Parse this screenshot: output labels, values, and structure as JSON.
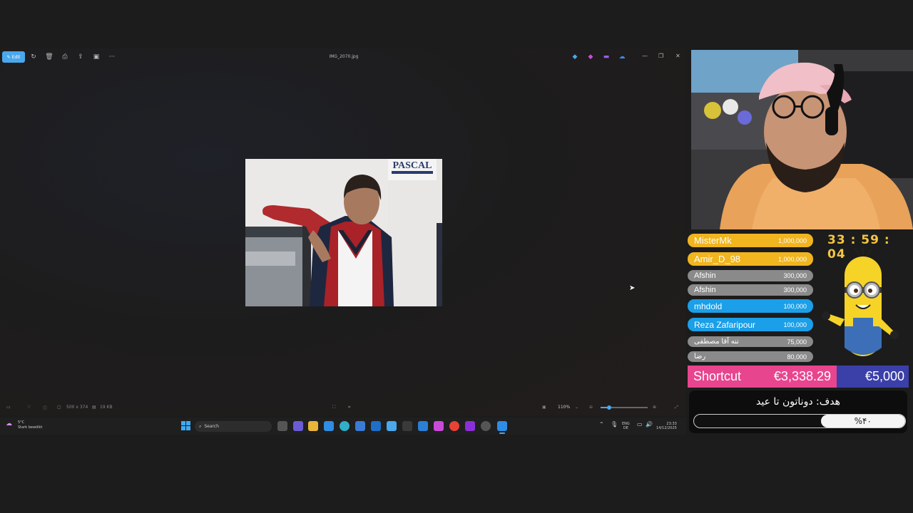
{
  "viewer": {
    "edit_label": "Edit",
    "filename": "IMG_2070.jpg",
    "photo_sign_text": "PASCAL",
    "status": {
      "dimensions": "500 x 374",
      "filesize": "19 KB",
      "zoom": "110%"
    }
  },
  "taskbar": {
    "weather_temp": "5°C",
    "weather_desc": "Stark bewölkt",
    "search_placeholder": "Search",
    "lang": "ENG",
    "region": "DE",
    "time": "23:33",
    "date": "14/12/2025"
  },
  "stream": {
    "timer": "33 : 59 : 04",
    "donors": [
      {
        "name": "MisterMk",
        "amount": "1,000,000",
        "tier": "gold"
      },
      {
        "name": "Amir_D_98",
        "amount": "1,000,000",
        "tier": "gold"
      },
      {
        "name": "Afshin",
        "amount": "300,000",
        "tier": "gray"
      },
      {
        "name": "Afshin",
        "amount": "300,000",
        "tier": "gray"
      },
      {
        "name": "mhdold",
        "amount": "100,000",
        "tier": "blue"
      },
      {
        "name": "Reza Zafaripour",
        "amount": "100,000",
        "tier": "blue"
      },
      {
        "name": "ننه آقا مصطفی",
        "amount": "75,000",
        "tier": "gray"
      },
      {
        "name": "رضا",
        "amount": "80,000",
        "tier": "gray"
      }
    ],
    "shortcut_label": "Shortcut",
    "shortcut_raised": "€3,338.29",
    "shortcut_goal": "€5,000",
    "goal_title": "هدف: دوناتون تا عید",
    "goal_percent_label": "%۴۰",
    "goal_percent": 40,
    "colors": {
      "gold": "#f0b51f",
      "blue": "#1a9fe8",
      "gray": "#8a8a8a",
      "pink": "#e8458f",
      "navy": "#3b3fa8"
    }
  }
}
